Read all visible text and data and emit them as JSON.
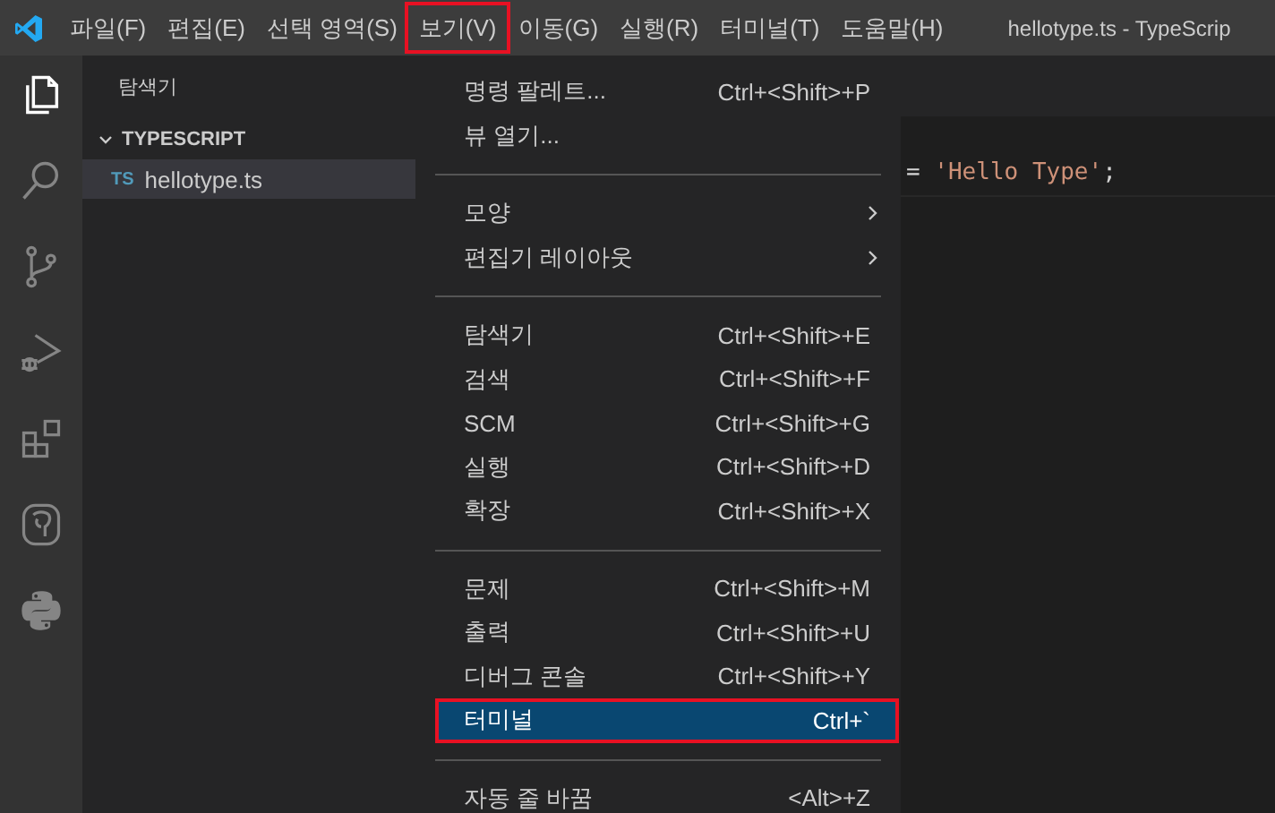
{
  "menubar": [
    {
      "label": "파일(F)",
      "annotated": false
    },
    {
      "label": "편집(E)",
      "annotated": false
    },
    {
      "label": "선택 영역(S)",
      "annotated": false
    },
    {
      "label": "보기(V)",
      "annotated": true
    },
    {
      "label": "이동(G)",
      "annotated": false
    },
    {
      "label": "실행(R)",
      "annotated": false
    },
    {
      "label": "터미널(T)",
      "annotated": false
    },
    {
      "label": "도움말(H)",
      "annotated": false
    }
  ],
  "window": {
    "title": "hellotype.ts - TypeScrip"
  },
  "activity_bar": [
    {
      "kind": "files",
      "selected": true
    },
    {
      "kind": "search",
      "selected": false
    },
    {
      "kind": "scm",
      "selected": false
    },
    {
      "kind": "debug",
      "selected": false
    },
    {
      "kind": "extensions",
      "selected": false
    },
    {
      "kind": "database",
      "selected": false
    },
    {
      "kind": "python",
      "selected": false
    }
  ],
  "sidebar": {
    "title": "탐색기",
    "folder": {
      "name": "TYPESCRIPT",
      "expanded": true
    },
    "files": [
      {
        "icon_text": "TS",
        "name": "hellotype.ts",
        "selected": true
      }
    ]
  },
  "editor": {
    "code_tokens": [
      {
        "kind": "operator",
        "text": "="
      },
      {
        "kind": "string",
        "text": "'Hello Type'"
      },
      {
        "kind": "punctuation",
        "text": ";"
      }
    ]
  },
  "view_menu": [
    [
      {
        "label": "명령 팔레트...",
        "shortcut": "Ctrl+<Shift>+P",
        "submenu": false,
        "selected": false,
        "annotated": false
      },
      {
        "label": "뷰 열기...",
        "submenu": false,
        "selected": false,
        "annotated": false
      }
    ],
    [
      {
        "label": "모양",
        "submenu": true,
        "selected": false,
        "annotated": false
      },
      {
        "label": "편집기 레이아웃",
        "submenu": true,
        "selected": false,
        "annotated": false
      }
    ],
    [
      {
        "label": "탐색기",
        "shortcut": "Ctrl+<Shift>+E",
        "submenu": false,
        "selected": false,
        "annotated": false
      },
      {
        "label": "검색",
        "shortcut": "Ctrl+<Shift>+F",
        "submenu": false,
        "selected": false,
        "annotated": false
      },
      {
        "label": "SCM",
        "shortcut": "Ctrl+<Shift>+G",
        "submenu": false,
        "selected": false,
        "annotated": false
      },
      {
        "label": "실행",
        "shortcut": "Ctrl+<Shift>+D",
        "submenu": false,
        "selected": false,
        "annotated": false
      },
      {
        "label": "확장",
        "shortcut": "Ctrl+<Shift>+X",
        "submenu": false,
        "selected": false,
        "annotated": false
      }
    ],
    [
      {
        "label": "문제",
        "shortcut": "Ctrl+<Shift>+M",
        "submenu": false,
        "selected": false,
        "annotated": false
      },
      {
        "label": "출력",
        "shortcut": "Ctrl+<Shift>+U",
        "submenu": false,
        "selected": false,
        "annotated": false
      },
      {
        "label": "디버그 콘솔",
        "shortcut": "Ctrl+<Shift>+Y",
        "submenu": false,
        "selected": false,
        "annotated": false
      },
      {
        "label": "터미널",
        "shortcut": "Ctrl+`",
        "submenu": false,
        "selected": true,
        "annotated": true
      }
    ],
    [
      {
        "label": "자동 줄 바꿈",
        "shortcut": "<Alt>+Z",
        "submenu": false,
        "selected": false,
        "annotated": false
      }
    ]
  ]
}
